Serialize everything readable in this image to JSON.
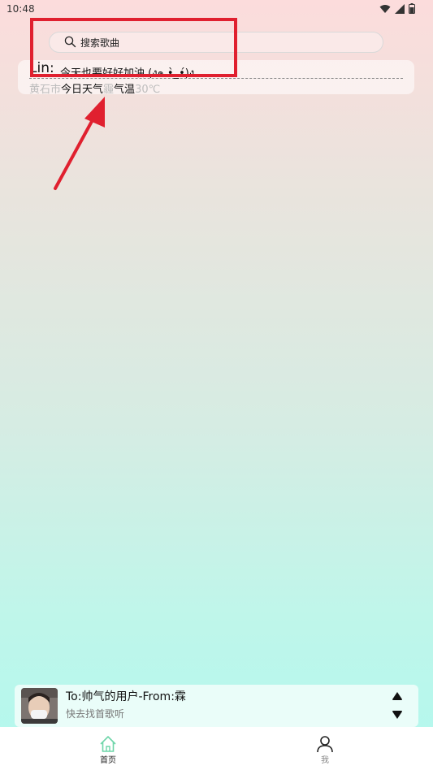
{
  "status": {
    "time": "10:48"
  },
  "search": {
    "placeholder": "搜索歌曲"
  },
  "greeting": {
    "name": "Lin:",
    "message": "今天也要好好加油 (ง๑ •̀_•́)ง"
  },
  "weather": {
    "city": "黄石市",
    "label": "今日天气",
    "condition": "霾",
    "temp_label": "气温",
    "temp": "30℃"
  },
  "player": {
    "title": "To:帅气的用户-From:霖",
    "subtitle": "快去找首歌听"
  },
  "nav": {
    "items": [
      {
        "label": "首页",
        "active": true
      },
      {
        "label": "我",
        "active": false
      }
    ]
  },
  "colors": {
    "annotation": "#e0202f",
    "nav_active": "#6dd5a8",
    "nav_inactive": "#888888"
  }
}
